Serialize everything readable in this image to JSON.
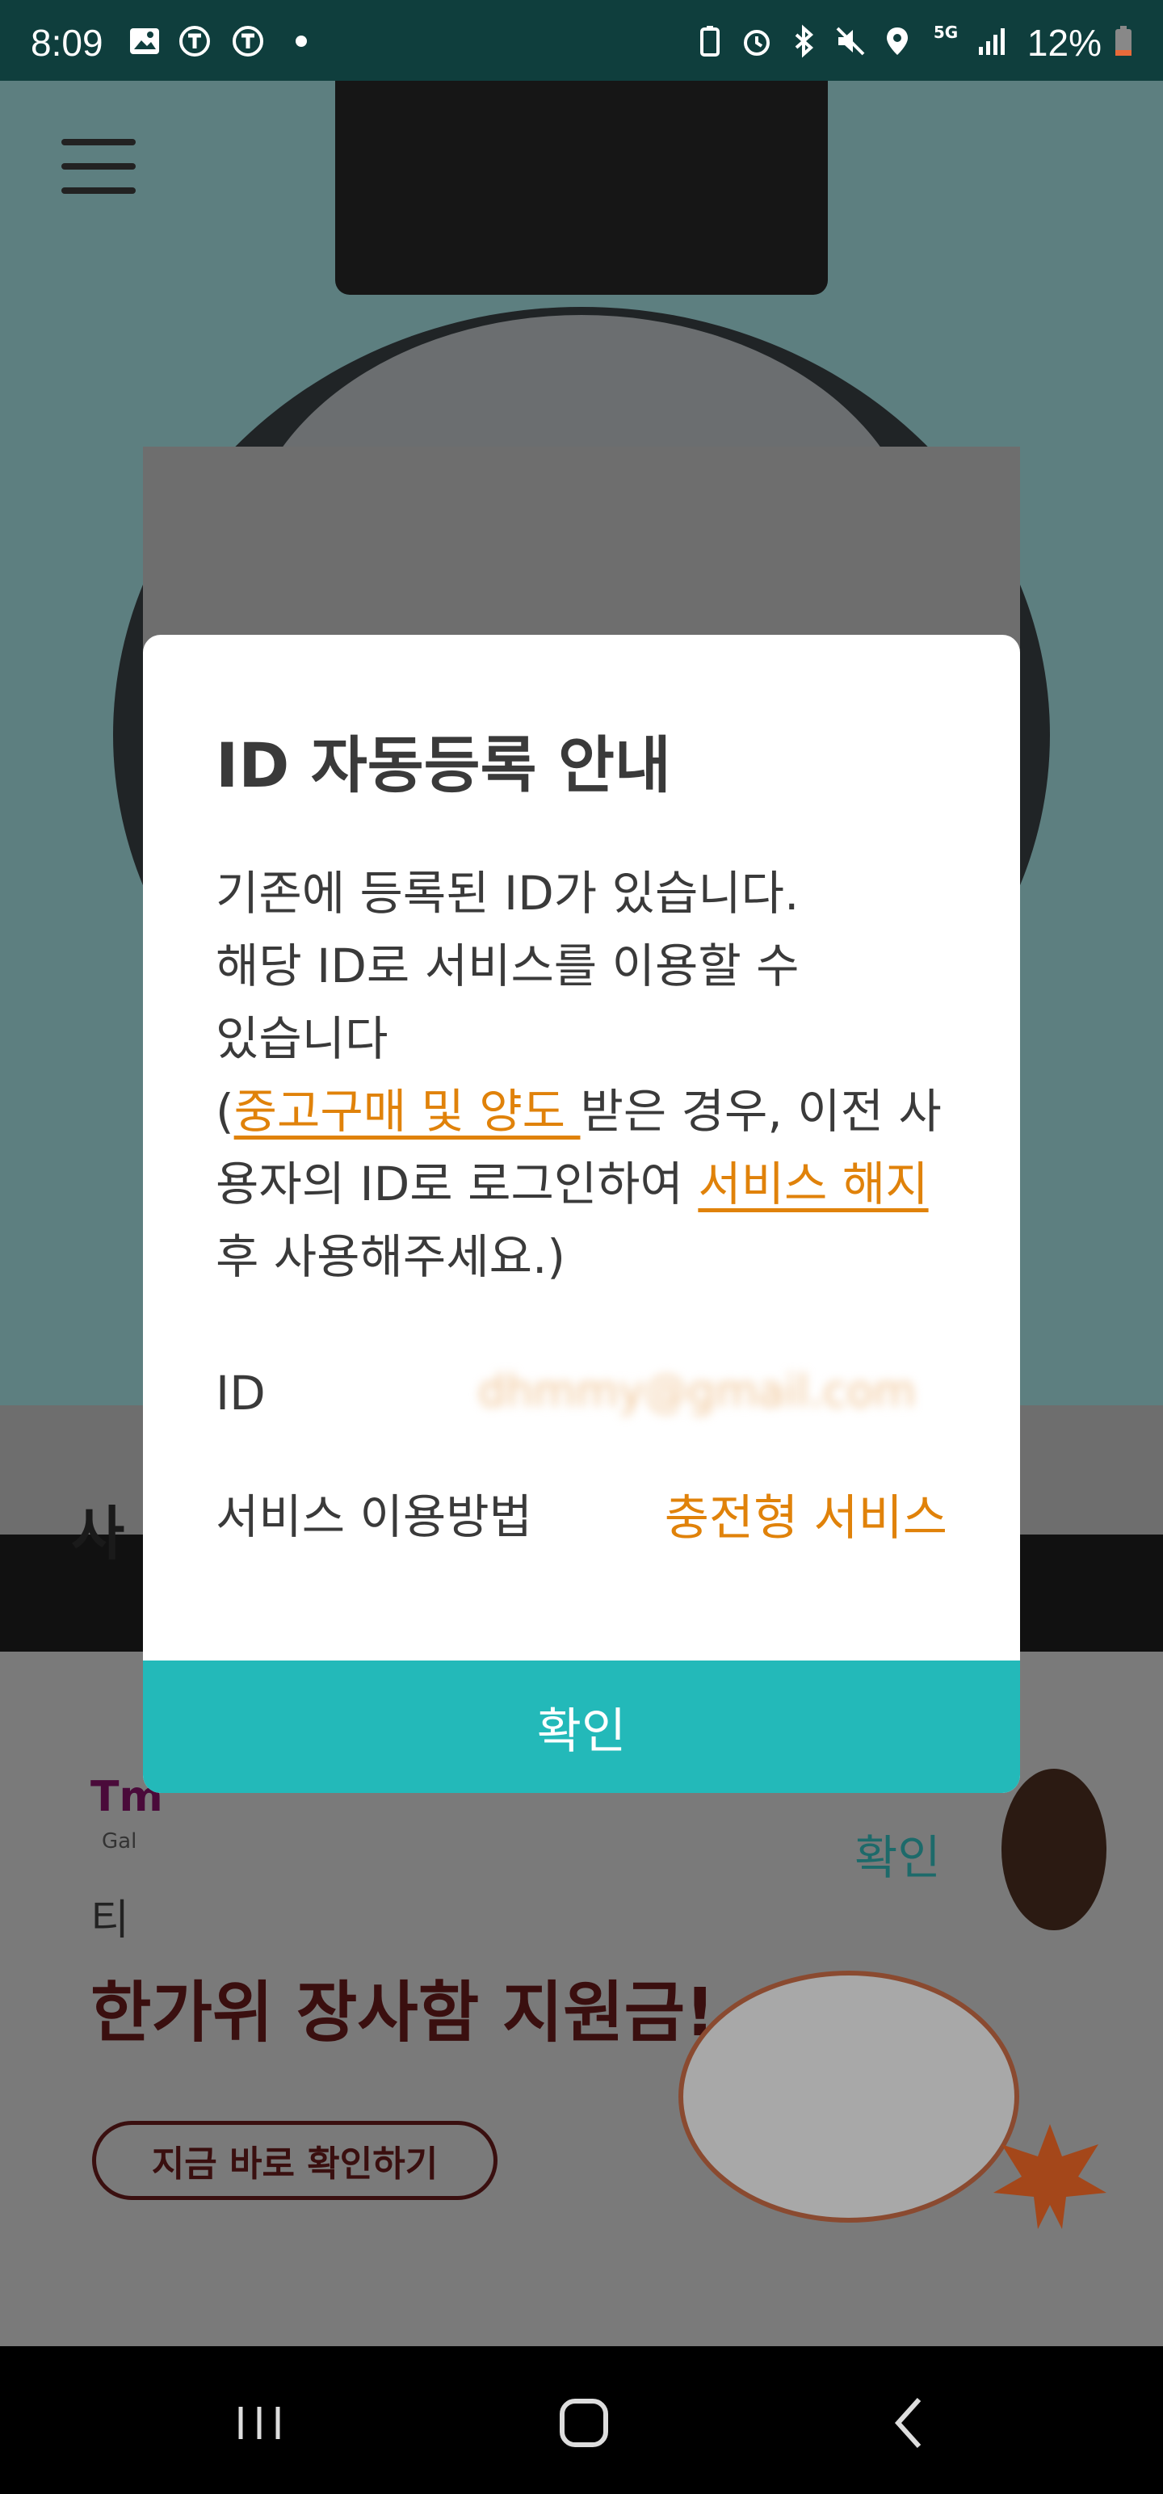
{
  "status_bar": {
    "time": "8:09",
    "battery": "12%",
    "icons": [
      "gallery-icon",
      "t-app-icon",
      "t-app-icon",
      "dot-icon",
      "battery-saver-icon",
      "alarm-icon",
      "bluetooth-icon",
      "mute-icon",
      "location-icon",
      "5g-icon",
      "signal-icon",
      "battery-icon"
    ]
  },
  "background_app": {
    "section_title_partial": "사",
    "banner": {
      "logo": "Tm",
      "logo_sub": "Gal",
      "confirm": "확인",
      "subtitle": "티",
      "title": "한가위 장사함 지원금!",
      "cta": "지금 바로 확인하기"
    }
  },
  "dialog": {
    "title": "ID 자동등록 안내",
    "message_lines": [
      "기존에 등록된 ID가 있습니다.",
      "해당 ID로 서비스를 이용할 수",
      "있습니다"
    ],
    "note": {
      "open": "(",
      "link1": "중고구매 및 양도 ",
      "mid": "받은 경우, 이전 사용자의 ID로 로그인하여 ",
      "link2": "서비스 해지",
      "end": " 후 사용해주세요.)"
    },
    "id_label": "ID",
    "id_value": "dhmmy@gmail.com",
    "service_label": "서비스 이용방법",
    "service_value": "충전형 서비스",
    "confirm_button": "확인"
  },
  "colors": {
    "accent_teal": "#23b9b9",
    "link_orange": "#e0820a",
    "status_bar": "#0f3e3d"
  }
}
